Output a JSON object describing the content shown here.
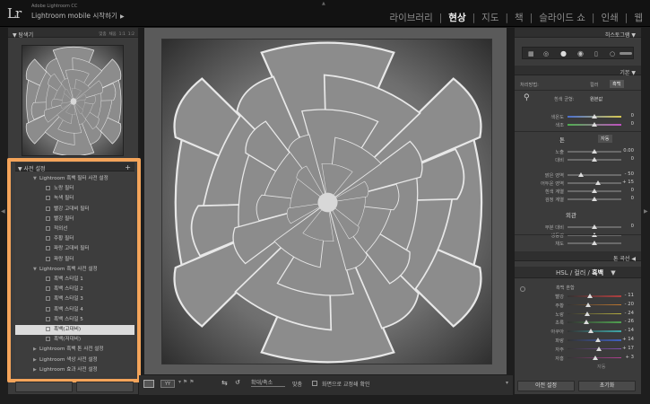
{
  "app": {
    "logo": "Lr",
    "product": "Adobe Lightroom CC",
    "mobile_label": "Lightroom mobile 시작하기",
    "mobile_arrow": "▶"
  },
  "modules": [
    "라이브러리",
    "현상",
    "지도",
    "책",
    "슬라이드 쇼",
    "인쇄",
    "웹"
  ],
  "active_module": "현상",
  "left": {
    "navigator": {
      "title": "탐색기",
      "options": [
        "맞춤",
        "채움",
        "1:1",
        "1:2"
      ]
    },
    "presets": {
      "title": "사전 설정",
      "add": "+",
      "rows": [
        {
          "type": "folder",
          "open": true,
          "label": "Lightroom 흑백 필터 사전 설정"
        },
        {
          "type": "item",
          "label": "노랑 필터"
        },
        {
          "type": "item",
          "label": "녹색 필터"
        },
        {
          "type": "item",
          "label": "빨강 고대비 필터"
        },
        {
          "type": "item",
          "label": "빨강 필터"
        },
        {
          "type": "item",
          "label": "적외선"
        },
        {
          "type": "item",
          "label": "주황 필터"
        },
        {
          "type": "item",
          "label": "파랑 고대비 필터"
        },
        {
          "type": "item",
          "label": "파랑 필터"
        },
        {
          "type": "folder",
          "open": true,
          "label": "Lightroom 흑백 사전 설정"
        },
        {
          "type": "item",
          "label": "흑백 스타일 1"
        },
        {
          "type": "item",
          "label": "흑백 스타일 2"
        },
        {
          "type": "item",
          "label": "흑백 스타일 3"
        },
        {
          "type": "item",
          "label": "흑백 스타일 4"
        },
        {
          "type": "item",
          "label": "흑백 스타일 5"
        },
        {
          "type": "item",
          "selected": true,
          "label": "흑백(고대비)"
        },
        {
          "type": "item",
          "label": "흑백(저대비)"
        },
        {
          "type": "folder",
          "open": false,
          "label": "Lightroom 흑백 톤 사전 설정"
        },
        {
          "type": "folder",
          "open": false,
          "label": "Lightroom 색상 사전 설정"
        },
        {
          "type": "folder",
          "open": false,
          "label": "Lightroom 효과 사전 설정"
        }
      ]
    }
  },
  "toolbar": {
    "zoom_label": "확대/축소",
    "fit_label": "맞춤",
    "proof_label": "화면으로 교정쇄 확인"
  },
  "right": {
    "histogram_title": "히스토그램",
    "basic": {
      "title": "기본",
      "treatment_label": "처리방법:",
      "treatment_color": "컬러",
      "treatment_bw": "흑백",
      "wb_label": "흰색 균형:",
      "wb_value": "원본값",
      "temp_label": "색온도",
      "temp_value": "0",
      "tint_label": "색조",
      "tint_value": "0",
      "tone_label": "톤",
      "auto_label": "자동",
      "exposure_label": "노출",
      "exposure_value": "0.00",
      "contrast_label": "대비",
      "contrast_value": "0",
      "highlights_label": "밝은 영역",
      "highlights_value": "- 50",
      "shadows_label": "어두운 영역",
      "shadows_value": "+ 15",
      "whites_label": "흰색 계열",
      "whites_value": "0",
      "blacks_label": "검정 계열",
      "blacks_value": "0",
      "presence_label": "외관",
      "clarity_label": "부분 대비",
      "clarity_value": "0",
      "vibrance_label": "생동감",
      "saturation_label": "채도"
    },
    "tone_curve_title": "톤 곡선",
    "hsl": {
      "tabs": [
        "HSL",
        "컬러",
        "흑백"
      ],
      "mix_label": "흑백 혼합",
      "rows": [
        {
          "label": "빨강",
          "value": "- 11",
          "pct": 0.42,
          "color": "#b04040"
        },
        {
          "label": "주황",
          "value": "- 20",
          "pct": 0.38,
          "color": "#c07830"
        },
        {
          "label": "노랑",
          "value": "- 24",
          "pct": 0.36,
          "color": "#b8b040"
        },
        {
          "label": "초록",
          "value": "- 26",
          "pct": 0.35,
          "color": "#50a050"
        },
        {
          "label": "아쿠아",
          "value": "- 14",
          "pct": 0.43,
          "color": "#40a8a8"
        },
        {
          "label": "파랑",
          "value": "+ 14",
          "pct": 0.57,
          "color": "#4060c0"
        },
        {
          "label": "자주",
          "value": "+ 17",
          "pct": 0.58,
          "color": "#8050b0"
        },
        {
          "label": "자홍",
          "value": "+ 3",
          "pct": 0.52,
          "color": "#b04090"
        }
      ],
      "auto_label": "자동"
    },
    "prev_button": "이전 설정",
    "reset_button": "초기화"
  }
}
